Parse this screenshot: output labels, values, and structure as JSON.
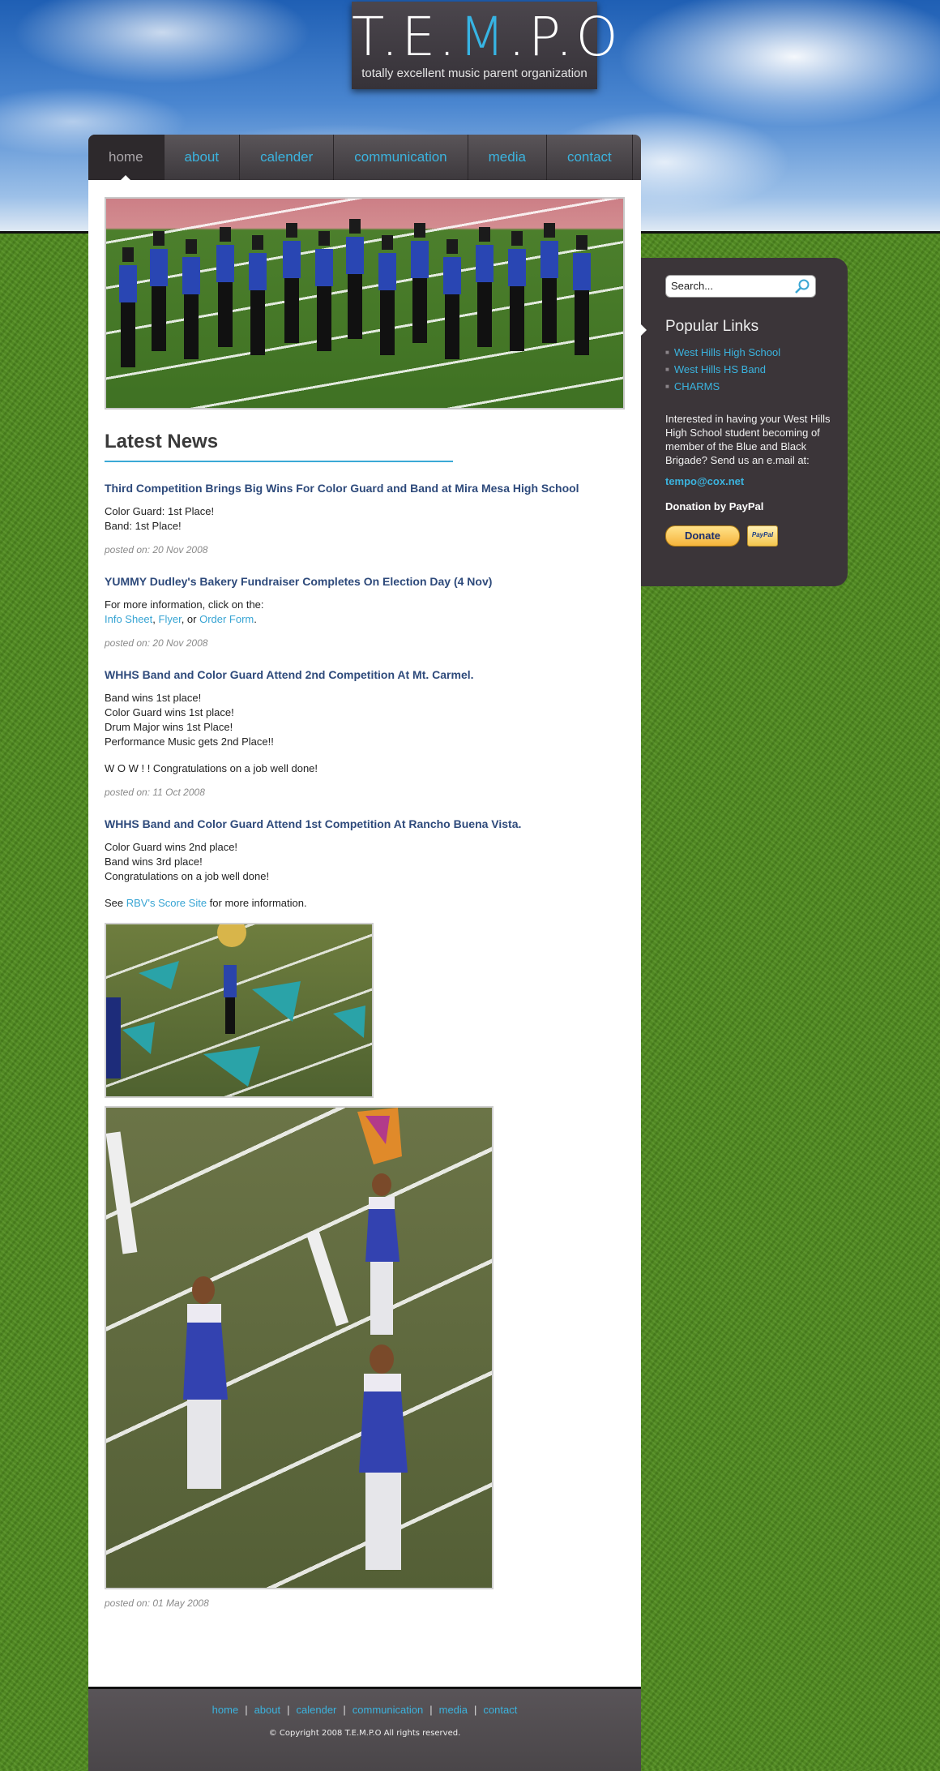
{
  "logo": {
    "letters": [
      "T.",
      "E.",
      "M",
      ".P.",
      "O"
    ],
    "tagline": "totally excellent music parent organization"
  },
  "nav": [
    {
      "label": "home"
    },
    {
      "label": "about"
    },
    {
      "label": "calender"
    },
    {
      "label": "communication"
    },
    {
      "label": "media"
    },
    {
      "label": "contact"
    }
  ],
  "news_heading": "Latest News",
  "posts": [
    {
      "title": "Third Competition Brings Big Wins For Color Guard and Band at Mira Mesa High School",
      "lines": [
        "Color Guard: 1st Place!",
        "Band: 1st Place!"
      ],
      "posted": "posted on: 20 Nov 2008"
    },
    {
      "title": "YUMMY Dudley's Bakery Fundraiser Completes On Election Day (4 Nov)",
      "intro": "For more information, click on the:",
      "links": [
        "Info Sheet",
        "Flyer",
        "Order Form"
      ],
      "sep1": ", ",
      "sep2": ", or ",
      "end": ".",
      "posted": "posted on: 20 Nov 2008"
    },
    {
      "title": "WHHS Band and Color Guard Attend 2nd Competition At Mt. Carmel.",
      "lines": [
        "Band wins 1st place!",
        "Color Guard wins 1st place!",
        "Drum Major wins 1st Place!",
        "Performance Music gets 2nd Place!!"
      ],
      "extra": "W O W ! ! Congratulations on a job well done!",
      "posted": "posted on: 11 Oct 2008"
    },
    {
      "title": "WHHS Band and Color Guard Attend 1st Competition At Rancho Buena Vista.",
      "lines": [
        "Color Guard wins 2nd place!",
        "Band wins 3rd place!",
        "Congratulations on a job well done!"
      ],
      "see_prefix": "See ",
      "see_link": "RBV's Score Site",
      "see_suffix": " for more information.",
      "posted": "posted on: 01 May 2008"
    }
  ],
  "sidebar": {
    "search_placeholder": "Search...",
    "heading": "Popular Links",
    "links": [
      "West Hills High School",
      "West Hills HS Band",
      "CHARMS"
    ],
    "blurb": "Interested in having your West Hills High School student becoming of member of the Blue and Black Brigade? Send us an e.mail at:",
    "email": "tempo@cox.net",
    "donation_label": "Donation by PayPal",
    "donate_button": "Donate",
    "paypal_badge": "PayPal"
  },
  "footer": {
    "links": [
      "home",
      "about",
      "calender",
      "communication",
      "media",
      "contact"
    ],
    "separator": "|",
    "copyright": "© Copyright 2008 T.E.M.P.O All rights reserved."
  }
}
